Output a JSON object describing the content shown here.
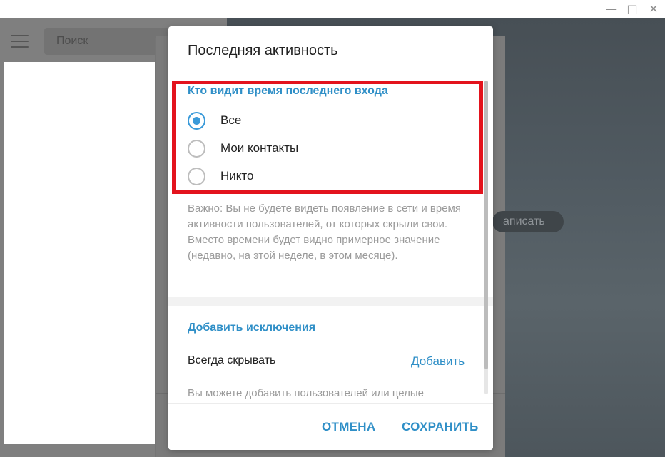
{
  "window": {
    "min_icon": "—",
    "max_icon": "□",
    "close_icon": "✕"
  },
  "sidebar": {
    "search_placeholder": "Поиск"
  },
  "chat": {
    "write_pill": "аписать"
  },
  "dialog": {
    "title": "Последняя активность",
    "section_title": "Кто видит время последнего входа",
    "options": [
      {
        "label": "Все",
        "checked": true
      },
      {
        "label": "Мои контакты",
        "checked": false
      },
      {
        "label": "Никто",
        "checked": false
      }
    ],
    "note": "Важно: Вы не будете видеть появление в сети и время активности пользователей, от которых скрыли свои. Вместо времени будет видно примерное значение (недавно, на этой неделе, в этом месяце).",
    "exceptions_title": "Добавить исключения",
    "always_hide_label": "Всегда скрывать",
    "add_label": "Добавить",
    "partial_note": "Вы можете добавить пользователей или целые",
    "cancel_label": "ОТМЕНА",
    "save_label": "СОХРАНИТЬ"
  },
  "colors": {
    "accent": "#2f8fc7",
    "radio_active": "#3a9ad9",
    "highlight_border": "#e3131d"
  }
}
